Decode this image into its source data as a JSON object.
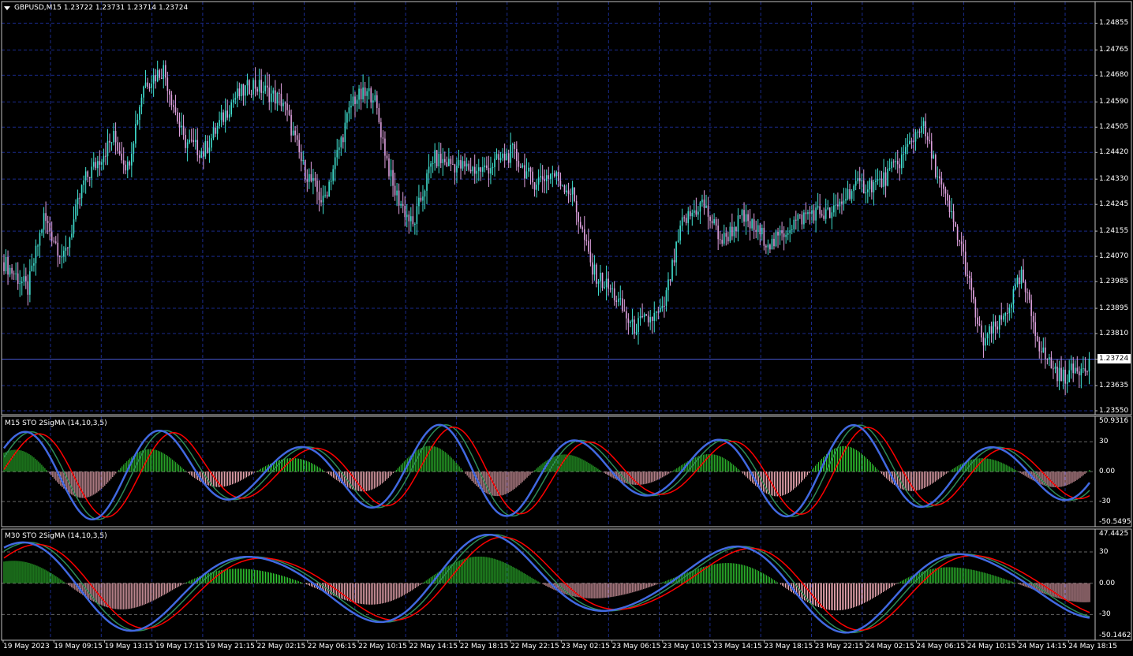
{
  "window": {
    "symbol_title": "GBPUSD,M15  1.23722 1.23731 1.23714 1.23724",
    "current_price": "1.23724"
  },
  "colors": {
    "background": "#000000",
    "grid": "#1a2a8a",
    "bull_candle": "#40e0d0",
    "bear_candle": "#dda0dd",
    "stoch_main": "#4169e1",
    "stoch_signal_a": "#2e8b57",
    "stoch_signal_b": "#ff0000",
    "hist_positive": "#32cd32",
    "hist_negative": "#ffb6c1",
    "frame": "#c0c0c0"
  },
  "price_axis": {
    "labels": [
      "1.24855",
      "1.24765",
      "1.24680",
      "1.24590",
      "1.24505",
      "1.24420",
      "1.24330",
      "1.24245",
      "1.24155",
      "1.24070",
      "1.23985",
      "1.23895",
      "1.23810",
      "1.23724",
      "1.23635",
      "1.23550"
    ],
    "min": 1.2355,
    "max": 1.2488
  },
  "indicator_1": {
    "title": "M15 STO 2SigMA (14,10,3,5)",
    "axis_labels": [
      "50.9316",
      "30",
      "0.00",
      "-30",
      "-50.5495"
    ]
  },
  "indicator_2": {
    "title": "M30 STO 2SigMA (14,10,3,5)",
    "axis_labels": [
      "47.4425",
      "30",
      "0.00",
      "-30",
      "-50.1462"
    ]
  },
  "time_axis": {
    "labels": [
      "19 May 2023",
      "19 May 09:15",
      "19 May 13:15",
      "19 May 17:15",
      "19 May 21:15",
      "22 May 02:15",
      "22 May 06:15",
      "22 May 10:15",
      "22 May 14:15",
      "22 May 18:15",
      "22 May 22:15",
      "23 May 02:15",
      "23 May 06:15",
      "23 May 10:15",
      "23 May 14:15",
      "23 May 18:15",
      "23 May 22:15",
      "24 May 02:15",
      "24 May 06:15",
      "24 May 10:15",
      "24 May 14:15",
      "24 May 18:15"
    ]
  }
}
